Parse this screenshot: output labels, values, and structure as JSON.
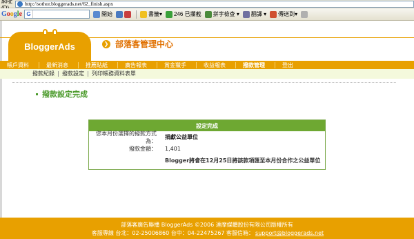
{
  "browser": {
    "address_label": "網址(D)",
    "url": "http://sothor.bloggerads.net/62_finish.aspx"
  },
  "toolbar": {
    "google_search_value": "",
    "go_label": "開始",
    "bookmarks_label": "書籤▾",
    "blocked_label": "246 已攔截",
    "spellcheck_label": "拼字檢查 ▾",
    "translate_label": "翻譯 ▾",
    "sendto_label": "傳送到▾"
  },
  "header": {
    "logo_text": "BloggerAds",
    "page_heading": "部落客管理中心"
  },
  "nav": {
    "items": [
      "帳戶資料",
      "最新消息",
      "推薦貼紙",
      "廣告報表",
      "賞金獵手",
      "收益報表",
      "撥款管理",
      "登出"
    ],
    "active_index": 6
  },
  "subnav": {
    "items": [
      "撥款紀錄",
      "撥款設定",
      "列印帳務資料表單"
    ]
  },
  "page": {
    "title": "撥款設定完成"
  },
  "result": {
    "header": "設定完成",
    "method_label": "您本月份選擇的撥款方式為：",
    "method_value": "捐獻公益單位",
    "amount_label": "撥款金額：",
    "amount_value": "1,401",
    "note": "Blogger將會在12月25日將該款項匯至本月份合作之公益單位"
  },
  "footer": {
    "line1": "部落客廣告聯播 BloggerAds ©2006 達摩媒體股份有限公司版權所有",
    "line2_prefix": "客服專線 台北：02-25006860 台中：04-22475267 客服信箱：",
    "email": "support@bloggerads.net"
  },
  "colors": {
    "brand_orange": "#e8a000",
    "title_green": "#4a9a2a",
    "box_green": "#6ea832",
    "subnav_bg": "#f4f9dc"
  }
}
